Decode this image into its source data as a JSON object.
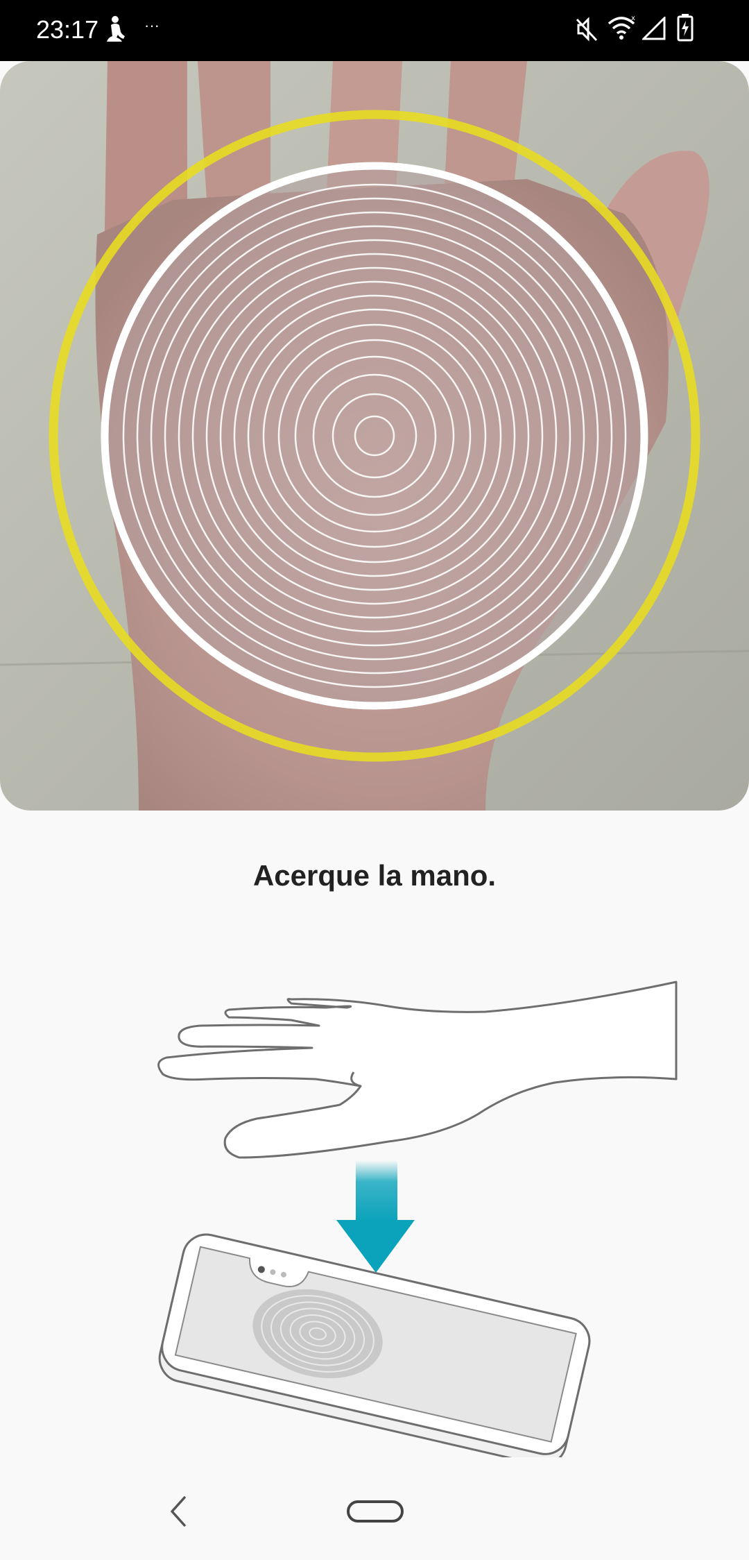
{
  "status_bar": {
    "time": "23:17",
    "overflow_indicator": "···",
    "left_icons": [
      "walk-icon"
    ],
    "right_icons": [
      "mute-icon",
      "wifi-icon",
      "signal-icon",
      "battery-charging-icon"
    ]
  },
  "camera": {
    "overlay_colors": {
      "outer_ring": "#e8dc22",
      "inner_ring": "#ffffff"
    }
  },
  "instruction": {
    "text": "Acerque la mano."
  },
  "illustration": {
    "arrow_color": "#0ba3bb",
    "icons": [
      "hand-illustration",
      "down-arrow-icon",
      "phone-illustration"
    ]
  },
  "nav_bar": {
    "buttons": [
      "back-icon",
      "home-icon"
    ]
  }
}
